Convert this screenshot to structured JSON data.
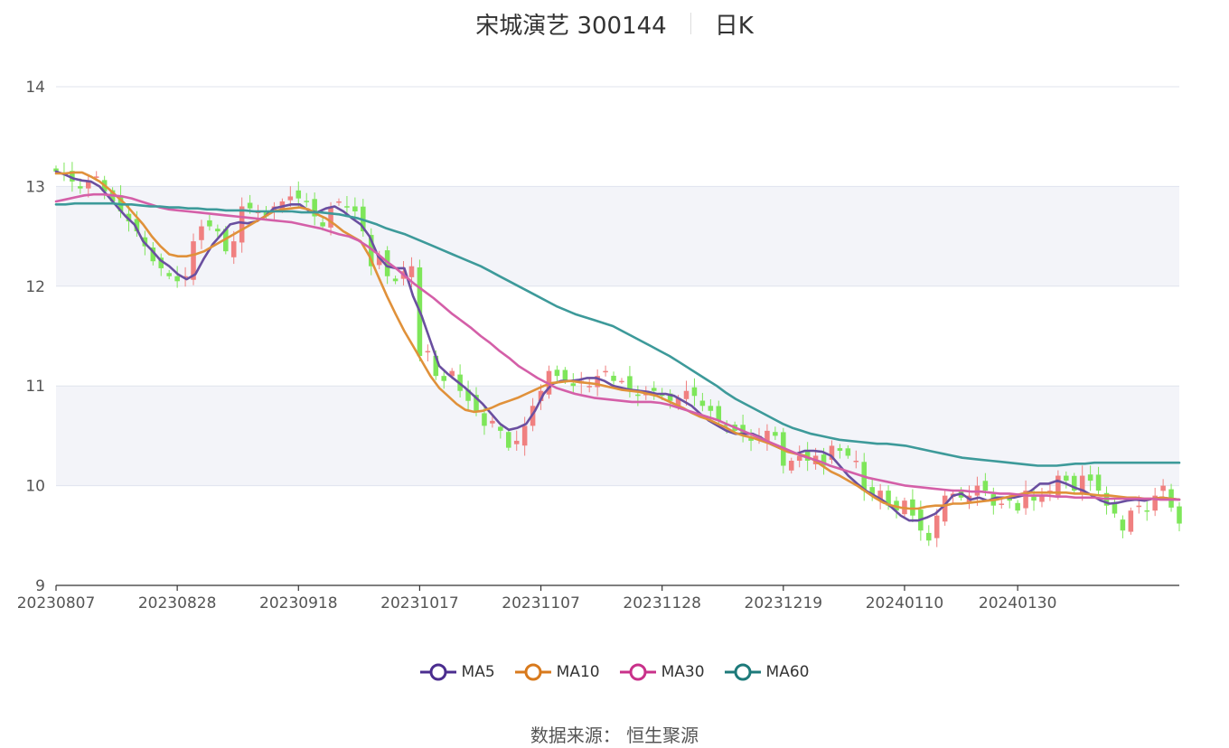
{
  "chart_data": {
    "type": "candlestick",
    "title": "宋城演艺 300144",
    "subtitle": "日K",
    "ylim": [
      9,
      14
    ],
    "yticks": [
      9,
      10,
      11,
      12,
      13,
      14
    ],
    "x_tick_labels": [
      "20230807",
      "20230828",
      "20230918",
      "20231017",
      "20231107",
      "20231128",
      "20231219",
      "20240110",
      "20240130"
    ],
    "x_tick_index": [
      0,
      15,
      30,
      45,
      60,
      75,
      90,
      105,
      119
    ],
    "grid": true,
    "legend_position": "bottom",
    "colors": {
      "up": "#f08080",
      "down": "#7ee65a",
      "MA5": "#6a4fa0",
      "MA10": "#e0913a",
      "MA30": "#d45fa8",
      "MA60": "#3d9a9a"
    },
    "close": [
      13.15,
      13.12,
      13.05,
      12.98,
      13.05,
      13.1,
      12.95,
      12.85,
      12.75,
      12.65,
      12.55,
      12.4,
      12.25,
      12.18,
      12.1,
      12.05,
      12.1,
      12.45,
      12.6,
      12.6,
      12.55,
      12.35,
      12.45,
      12.8,
      12.78,
      12.75,
      12.7,
      12.8,
      12.85,
      12.9,
      12.88,
      12.85,
      12.7,
      12.6,
      12.8,
      12.85,
      12.8,
      12.75,
      12.55,
      12.2,
      12.3,
      12.1,
      12.05,
      12.15,
      12.2,
      11.3,
      11.35,
      11.1,
      11.05,
      11.15,
      10.95,
      10.85,
      10.75,
      10.6,
      10.65,
      10.55,
      10.38,
      10.45,
      10.6,
      10.8,
      10.95,
      11.15,
      11.1,
      11.05,
      11.0,
      11.05,
      11.0,
      11.1,
      11.15,
      11.05,
      11.05,
      10.95,
      10.9,
      10.92,
      10.95,
      10.9,
      10.85,
      10.88,
      10.95,
      10.9,
      10.8,
      10.75,
      10.65,
      10.6,
      10.55,
      10.5,
      10.45,
      10.5,
      10.55,
      10.5,
      10.2,
      10.25,
      10.3,
      10.25,
      10.3,
      10.2,
      10.4,
      10.35,
      10.3,
      10.25,
      9.95,
      9.9,
      9.95,
      9.8,
      9.75,
      9.85,
      9.7,
      9.55,
      9.45,
      9.7,
      9.9,
      9.92,
      9.88,
      9.9,
      10.0,
      9.95,
      9.8,
      9.82,
      9.85,
      9.75,
      9.95,
      9.85,
      9.9,
      9.95,
      10.1,
      10.05,
      9.95,
      10.1,
      10.05,
      9.95,
      9.8,
      9.72,
      9.55,
      9.75,
      9.8,
      9.75,
      9.9,
      10.0,
      9.78,
      9.62
    ],
    "series": [
      {
        "name": "MA5",
        "values": [
          13.15,
          13.12,
          13.08,
          13.06,
          13.05,
          13.0,
          12.9,
          12.8,
          12.7,
          12.62,
          12.45,
          12.36,
          12.26,
          12.2,
          12.12,
          12.07,
          12.12,
          12.28,
          12.42,
          12.52,
          12.62,
          12.64,
          12.63,
          12.65,
          12.7,
          12.78,
          12.8,
          12.82,
          12.82,
          12.76,
          12.74,
          12.78,
          12.8,
          12.75,
          12.68,
          12.62,
          12.5,
          12.3,
          12.2,
          12.18,
          12.18,
          11.9,
          11.7,
          11.45,
          11.2,
          11.12,
          11.05,
          10.98,
          10.9,
          10.82,
          10.72,
          10.62,
          10.56,
          10.58,
          10.62,
          10.75,
          10.92,
          11.02,
          11.05,
          11.05,
          11.06,
          11.08,
          11.08,
          11.05,
          11.0,
          10.98,
          10.96,
          10.95,
          10.94,
          10.92,
          10.92,
          10.9,
          10.85,
          10.8,
          10.72,
          10.65,
          10.6,
          10.55,
          10.52,
          10.52,
          10.52,
          10.48,
          10.42,
          10.38,
          10.35,
          10.32,
          10.35,
          10.35,
          10.34,
          10.3,
          10.2,
          10.1,
          10.02,
          9.95,
          9.9,
          9.85,
          9.78,
          9.7,
          9.65,
          9.65,
          9.68,
          9.72,
          9.8,
          9.9,
          9.92,
          9.86,
          9.88,
          9.85,
          9.88,
          9.88,
          9.88,
          9.9,
          9.95,
          10.02,
          10.02,
          10.05,
          10.02,
          9.98,
          9.95,
          9.9,
          9.85,
          9.82,
          9.83,
          9.85,
          9.86,
          9.85,
          9.87,
          9.88,
          9.87,
          9.86
        ]
      },
      {
        "name": "MA10",
        "values": [
          13.13,
          13.13,
          13.14,
          13.14,
          13.1,
          13.05,
          12.98,
          12.9,
          12.82,
          12.72,
          12.62,
          12.5,
          12.4,
          12.32,
          12.3,
          12.3,
          12.32,
          12.35,
          12.4,
          12.45,
          12.5,
          12.55,
          12.6,
          12.65,
          12.7,
          12.75,
          12.77,
          12.78,
          12.79,
          12.77,
          12.72,
          12.68,
          12.62,
          12.55,
          12.5,
          12.45,
          12.3,
          12.1,
          11.9,
          11.72,
          11.55,
          11.4,
          11.25,
          11.1,
          10.98,
          10.9,
          10.82,
          10.76,
          10.74,
          10.75,
          10.78,
          10.82,
          10.85,
          10.88,
          10.92,
          10.96,
          11.0,
          11.03,
          11.04,
          11.05,
          11.04,
          11.03,
          11.02,
          11.0,
          10.98,
          10.96,
          10.95,
          10.94,
          10.92,
          10.9,
          10.86,
          10.82,
          10.78,
          10.73,
          10.69,
          10.66,
          10.62,
          10.58,
          10.53,
          10.5,
          10.48,
          10.45,
          10.42,
          10.38,
          10.34,
          10.32,
          10.3,
          10.26,
          10.2,
          10.14,
          10.1,
          10.05,
          10.0,
          9.94,
          9.88,
          9.83,
          9.8,
          9.78,
          9.77,
          9.77,
          9.79,
          9.8,
          9.8,
          9.82,
          9.82,
          9.83,
          9.84,
          9.85,
          9.86,
          9.88,
          9.9,
          9.92,
          9.93,
          9.93,
          9.93,
          9.93,
          9.93,
          9.92,
          9.92,
          9.91,
          9.9,
          9.9,
          9.89,
          9.88,
          9.88,
          9.87,
          9.87,
          9.88,
          9.87,
          9.86
        ]
      },
      {
        "name": "MA30",
        "values": [
          12.85,
          12.87,
          12.89,
          12.91,
          12.92,
          12.92,
          12.91,
          12.9,
          12.88,
          12.85,
          12.82,
          12.79,
          12.77,
          12.76,
          12.75,
          12.74,
          12.73,
          12.72,
          12.71,
          12.7,
          12.69,
          12.68,
          12.67,
          12.66,
          12.65,
          12.64,
          12.62,
          12.6,
          12.58,
          12.55,
          12.52,
          12.5,
          12.46,
          12.4,
          12.33,
          12.25,
          12.18,
          12.1,
          12.02,
          11.95,
          11.88,
          11.8,
          11.72,
          11.65,
          11.58,
          11.5,
          11.43,
          11.35,
          11.28,
          11.2,
          11.14,
          11.08,
          11.03,
          10.98,
          10.95,
          10.92,
          10.9,
          10.88,
          10.87,
          10.86,
          10.85,
          10.84,
          10.84,
          10.84,
          10.83,
          10.81,
          10.78,
          10.75,
          10.72,
          10.69,
          10.66,
          10.62,
          10.58,
          10.54,
          10.5,
          10.46,
          10.42,
          10.38,
          10.34,
          10.3,
          10.27,
          10.24,
          10.2,
          10.17,
          10.14,
          10.11,
          10.08,
          10.06,
          10.04,
          10.02,
          10.0,
          9.99,
          9.98,
          9.97,
          9.96,
          9.95,
          9.95,
          9.94,
          9.94,
          9.93,
          9.92,
          9.92,
          9.91,
          9.9,
          9.9,
          9.9,
          9.89,
          9.89,
          9.88,
          9.88,
          9.88,
          9.87,
          9.87,
          9.87,
          9.87,
          9.87,
          9.87,
          9.86,
          9.86,
          9.86
        ]
      },
      {
        "name": "MA60",
        "values": [
          12.82,
          12.82,
          12.83,
          12.83,
          12.83,
          12.83,
          12.83,
          12.82,
          12.82,
          12.81,
          12.8,
          12.8,
          12.79,
          12.79,
          12.78,
          12.78,
          12.77,
          12.77,
          12.76,
          12.76,
          12.76,
          12.75,
          12.75,
          12.75,
          12.75,
          12.75,
          12.74,
          12.74,
          12.74,
          12.73,
          12.72,
          12.7,
          12.68,
          12.65,
          12.62,
          12.58,
          12.55,
          12.52,
          12.48,
          12.44,
          12.4,
          12.36,
          12.32,
          12.28,
          12.24,
          12.2,
          12.15,
          12.1,
          12.05,
          12.0,
          11.95,
          11.9,
          11.85,
          11.8,
          11.76,
          11.72,
          11.69,
          11.66,
          11.63,
          11.6,
          11.55,
          11.5,
          11.45,
          11.4,
          11.35,
          11.3,
          11.24,
          11.18,
          11.12,
          11.06,
          11.0,
          10.93,
          10.87,
          10.82,
          10.77,
          10.72,
          10.67,
          10.62,
          10.58,
          10.55,
          10.52,
          10.5,
          10.48,
          10.46,
          10.45,
          10.44,
          10.43,
          10.42,
          10.42,
          10.41,
          10.4,
          10.38,
          10.36,
          10.34,
          10.32,
          10.3,
          10.28,
          10.27,
          10.26,
          10.25,
          10.24,
          10.23,
          10.22,
          10.21,
          10.2,
          10.2,
          10.2,
          10.21,
          10.22,
          10.22,
          10.23,
          10.23,
          10.23,
          10.23,
          10.23,
          10.23,
          10.23,
          10.23,
          10.23,
          10.23
        ]
      }
    ]
  },
  "legend": [
    {
      "label": "MA5",
      "color": "#4b2d8f"
    },
    {
      "label": "MA10",
      "color": "#d87a1d"
    },
    {
      "label": "MA30",
      "color": "#c9318a"
    },
    {
      "label": "MA60",
      "color": "#1d7a7a"
    }
  ],
  "source_text": "数据来源： 恒生聚源"
}
